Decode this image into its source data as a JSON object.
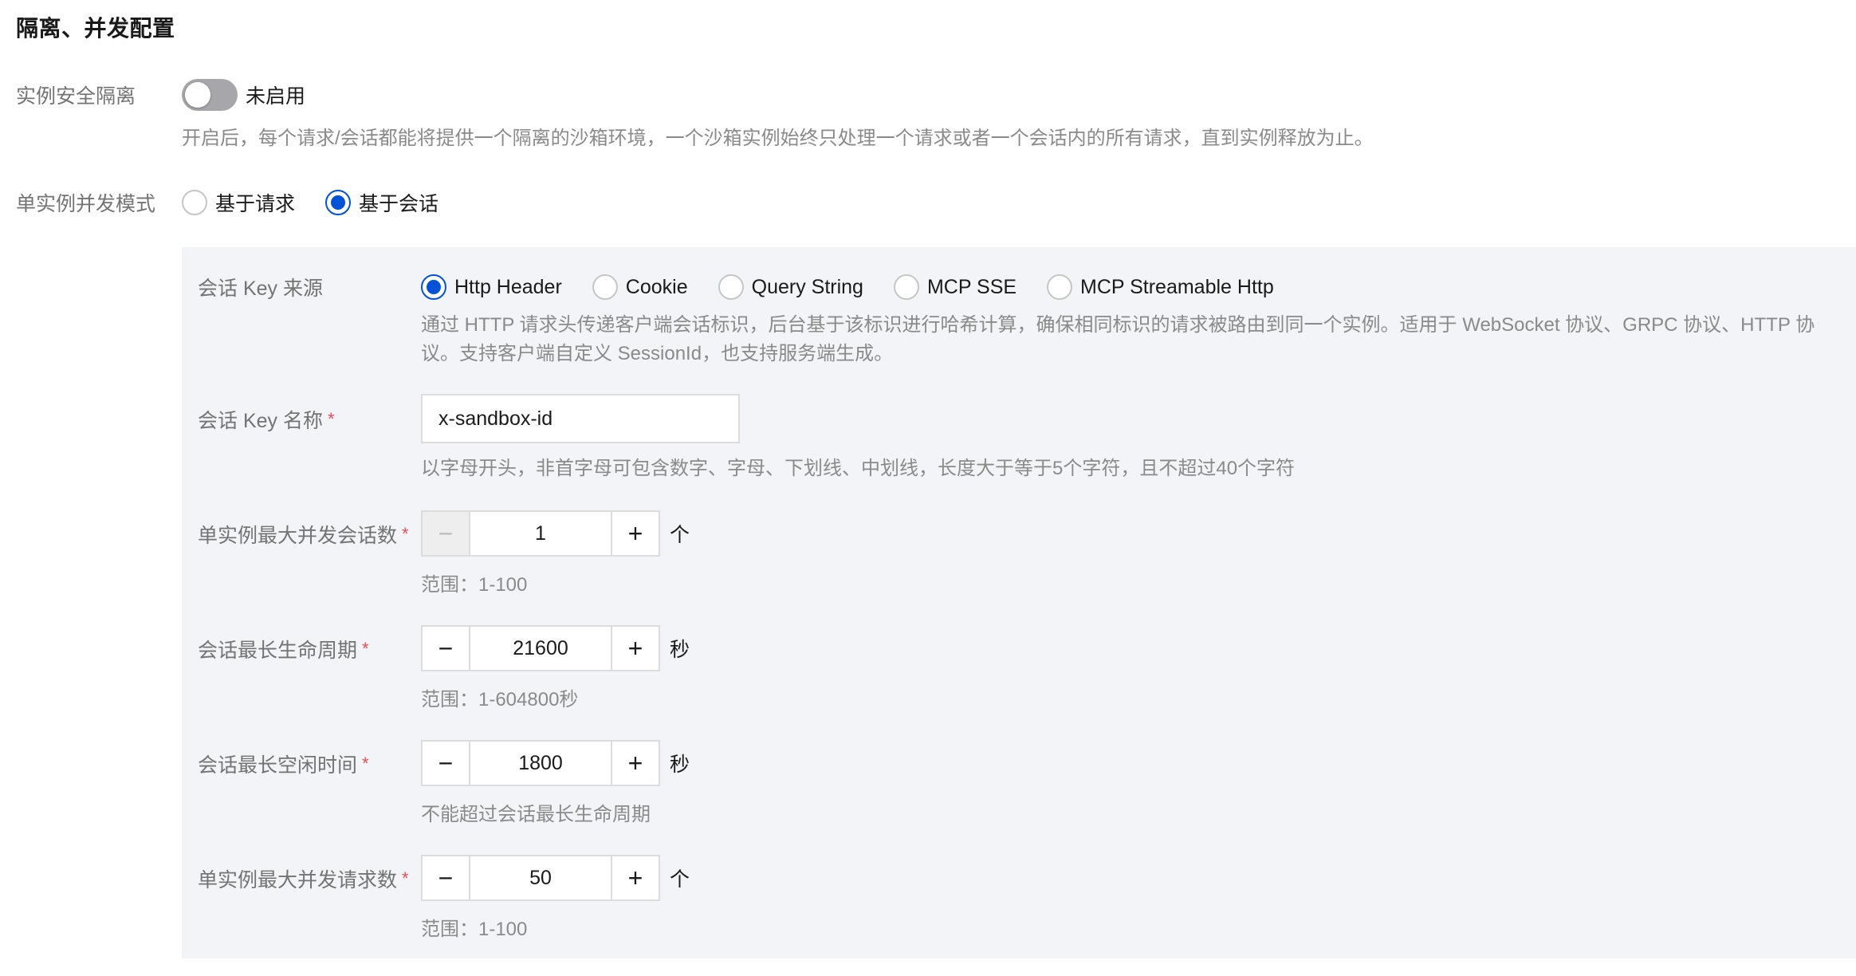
{
  "section_title": "隔离、并发配置",
  "isolation": {
    "label": "实例安全隔离",
    "toggle_state": "未启用",
    "hint": "开启后，每个请求/会话都能将提供一个隔离的沙箱环境，一个沙箱实例始终只处理一个请求或者一个会话内的所有请求，直到实例释放为止。"
  },
  "concurrency_mode": {
    "label": "单实例并发模式",
    "options": [
      "基于请求",
      "基于会话"
    ],
    "selected": "基于会话"
  },
  "session_key_source": {
    "label": "会话 Key 来源",
    "options": [
      "Http Header",
      "Cookie",
      "Query String",
      "MCP SSE",
      "MCP Streamable Http"
    ],
    "selected": "Http Header",
    "hint_line1": "通过 HTTP 请求头传递客户端会话标识，后台基于该标识进行哈希计算，确保相同标识的请求被路由到同一个实例。适用于 WebSocket 协议、GRPC 协议、HTTP 协",
    "hint_line2": "议。支持客户端自定义 SessionId，也支持服务端生成。"
  },
  "session_key_name": {
    "label": "会话 Key 名称",
    "required_mark": "*",
    "value": "x-sandbox-id",
    "hint": "以字母开头，非首字母可包含数字、字母、下划线、中划线，长度大于等于5个字符，且不超过40个字符"
  },
  "max_sessions": {
    "label": "单实例最大并发会话数",
    "required_mark": "*",
    "value": "1",
    "unit": "个",
    "hint": "范围：1-100",
    "minus_symbol": "−",
    "plus_symbol": "+"
  },
  "session_lifetime": {
    "label": "会话最长生命周期",
    "required_mark": "*",
    "value": "21600",
    "unit": "秒",
    "hint": "范围：1-604800秒",
    "minus_symbol": "−",
    "plus_symbol": "+"
  },
  "session_idle": {
    "label": "会话最长空闲时间",
    "required_mark": "*",
    "value": "1800",
    "unit": "秒",
    "hint": "不能超过会话最长生命周期",
    "minus_symbol": "−",
    "plus_symbol": "+"
  },
  "max_requests": {
    "label": "单实例最大并发请求数",
    "required_mark": "*",
    "value": "50",
    "unit": "个",
    "hint": "范围：1-100",
    "minus_symbol": "−",
    "plus_symbol": "+"
  },
  "colors": {
    "accent": "#0052d9",
    "required": "#e34d59",
    "panel_bg": "#f3f4f7",
    "toggle_off": "#a6a6ab"
  }
}
